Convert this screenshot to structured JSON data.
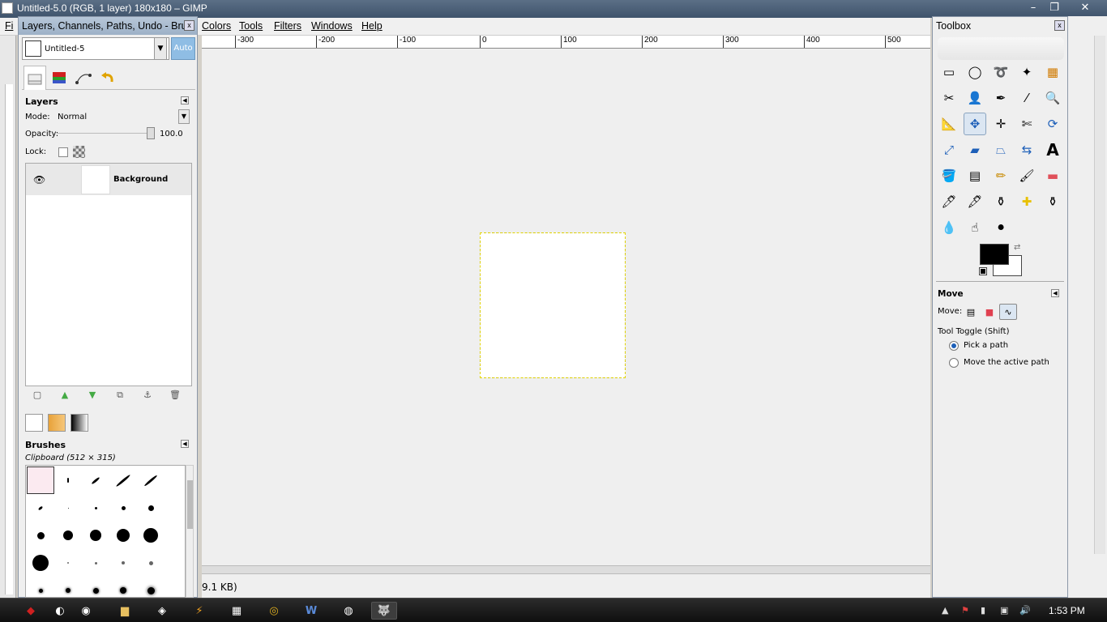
{
  "window": {
    "title": "Untitled-5.0 (RGB, 1 layer) 180x180 – GIMP",
    "minimize": "–",
    "maximize": "❐",
    "close": "✕"
  },
  "menu": [
    "Fi",
    "Colors",
    "Tools",
    "Filters",
    "Windows",
    "Help"
  ],
  "ruler": {
    "labels": [
      "-300",
      "-200",
      "-100",
      "0",
      "100",
      "200",
      "300",
      "400",
      "500"
    ]
  },
  "status": {
    "text": "9.1 KB)"
  },
  "dock": {
    "title": "Layers, Channels, Paths, Undo - Bru...",
    "image_name": "Untitled-5",
    "auto_label": "Auto",
    "layers": {
      "heading": "Layers",
      "mode_label": "Mode:",
      "mode_value": "Normal",
      "opacity_label": "Opacity:",
      "opacity_value": "100.0",
      "opacity_percent": 100,
      "lock_label": "Lock:",
      "items": [
        {
          "name": "Background",
          "visible": true
        }
      ]
    },
    "brushes": {
      "heading": "Brushes",
      "selected_info": "Clipboard (512 × 315)"
    }
  },
  "toolbox": {
    "title": "Toolbox",
    "fg_color": "#000000",
    "bg_color": "#ffffff",
    "options": {
      "heading": "Move",
      "move_label": "Move:",
      "toggle_label": "Tool Toggle  (Shift)",
      "radio_options": [
        "Pick a path",
        "Move the active path"
      ],
      "selected_option": 0
    }
  },
  "taskbar": {
    "clock": "1:53 PM"
  }
}
